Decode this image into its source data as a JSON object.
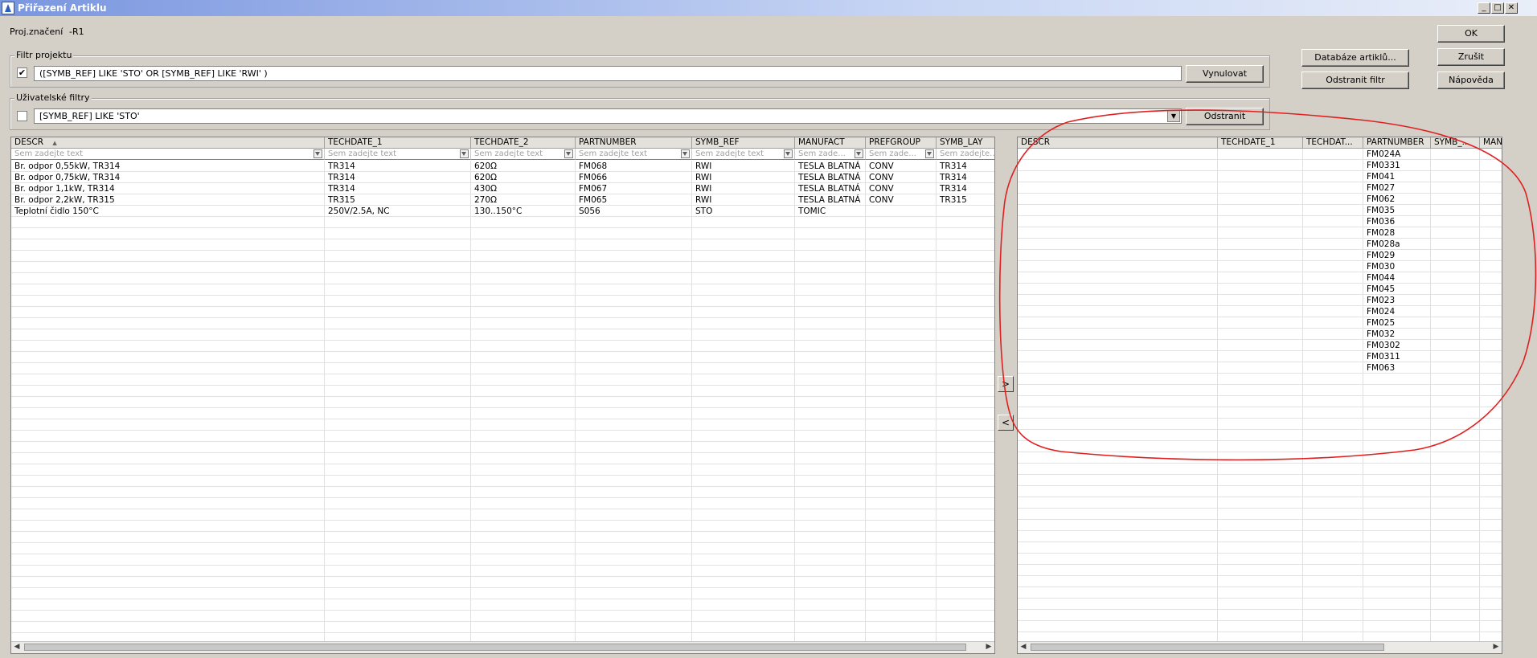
{
  "window": {
    "title": "Přiřazení Artiklu",
    "minimize": "_",
    "maximize": "□",
    "close": "✕"
  },
  "proj": {
    "label": "Proj.značení",
    "value": "-R1"
  },
  "project_filter": {
    "label": "Filtr projektu",
    "checked": "✔",
    "expression": "([SYMB_REF]  LIKE 'STO' OR [SYMB_REF]  LIKE 'RWI' )",
    "reset_label": "Vynulovat"
  },
  "user_filter": {
    "label": "Uživatelské filtry",
    "expression": "[SYMB_REF] LIKE 'STO'",
    "remove_label": "Odstranit",
    "dropdown_icon": "▼"
  },
  "buttons": {
    "database": "Databáze artiklů...",
    "remove_filter": "Odstranit filtr",
    "ok": "OK",
    "cancel": "Zrušit",
    "help": "Nápověda"
  },
  "transfer": {
    "add": ">",
    "remove": "<"
  },
  "left_grid": {
    "sort_icon": "▲",
    "columns": [
      {
        "label": "DESCR",
        "filter": "Sem zadejte text"
      },
      {
        "label": "TECHDATE_1",
        "filter": "Sem zadejte text"
      },
      {
        "label": "TECHDATE_2",
        "filter": "Sem zadejte text"
      },
      {
        "label": "PARTNUMBER",
        "filter": "Sem zadejte text"
      },
      {
        "label": "SYMB_REF",
        "filter": "Sem zadejte text"
      },
      {
        "label": "MANUFACT",
        "filter": "Sem zade..."
      },
      {
        "label": "PREFGROUP",
        "filter": "Sem zade..."
      },
      {
        "label": "SYMB_LAY",
        "filter": "Sem zadejte..."
      }
    ],
    "rows": [
      [
        "Br. odpor 0,55kW, TR314",
        "TR314",
        "620Ω",
        "FM068",
        "RWI",
        "TESLA BLATNÁ",
        "CONV",
        "TR314"
      ],
      [
        "Br. odpor 0,75kW, TR314",
        "TR314",
        "620Ω",
        "FM066",
        "RWI",
        "TESLA BLATNÁ",
        "CONV",
        "TR314"
      ],
      [
        "Br. odpor 1,1kW, TR314",
        "TR314",
        "430Ω",
        "FM067",
        "RWI",
        "TESLA BLATNÁ",
        "CONV",
        "TR314"
      ],
      [
        "Br. odpor 2,2kW, TR315",
        "TR315",
        "270Ω",
        "FM065",
        "RWI",
        "TESLA BLATNÁ",
        "CONV",
        "TR315"
      ],
      [
        "Teplotní čidlo 150°C",
        "250V/2.5A, NC",
        "130..150°C",
        "S056",
        "STO",
        "TOMIC",
        "",
        ""
      ]
    ]
  },
  "right_grid": {
    "columns": [
      "DESCR",
      "TECHDATE_1",
      "TECHDAT...",
      "PARTNUMBER",
      "SYMB_...",
      "MAN"
    ],
    "partnumbers": [
      "FM024A",
      "FM0331",
      "FM041",
      "FM027",
      "FM062",
      "FM035",
      "FM036",
      "FM028",
      "FM028a",
      "FM029",
      "FM030",
      "FM044",
      "FM045",
      "FM023",
      "FM024",
      "FM025",
      "FM032",
      "FM0302",
      "FM0311",
      "FM063"
    ]
  },
  "scroll": {
    "left": "◀",
    "right": "▶"
  },
  "annotation_color": "#e02020"
}
